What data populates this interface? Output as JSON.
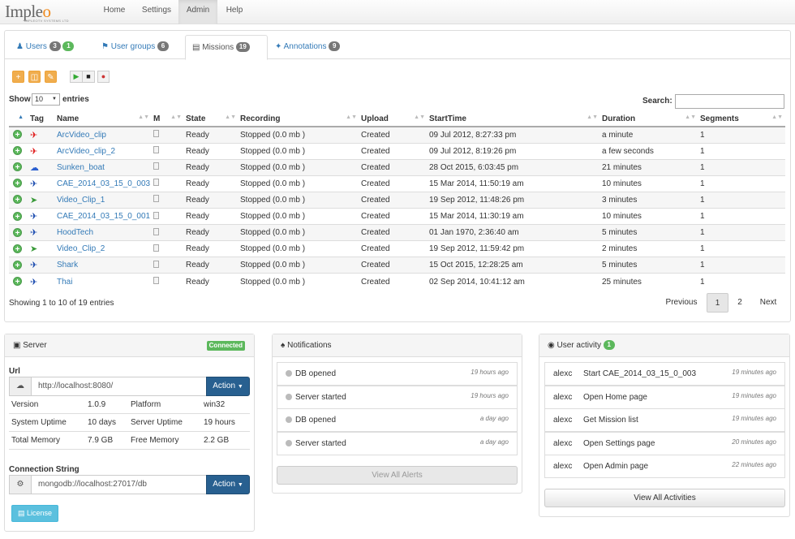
{
  "brand": {
    "logo": "Impleo",
    "logo_sub": "IMPLEOTV SYSTEMS LTD"
  },
  "nav": {
    "items": [
      {
        "label": "Home"
      },
      {
        "label": "Settings"
      },
      {
        "label": "Admin"
      },
      {
        "label": "Help"
      }
    ]
  },
  "tabs": [
    {
      "label": "Users",
      "icon": "user-icon",
      "badges": [
        "3",
        "1"
      ]
    },
    {
      "label": "User groups",
      "icon": "tags-icon",
      "badges": [
        "6"
      ]
    },
    {
      "label": "Missions",
      "icon": "film-icon",
      "badges": [
        "19"
      ]
    },
    {
      "label": "Annotations",
      "icon": "pushpin-icon",
      "badges": [
        "9"
      ]
    }
  ],
  "table": {
    "show_label": "Show",
    "entries_label": "entries",
    "page_size": "10",
    "search_label": "Search:",
    "columns": [
      "Tag",
      "Name",
      "M",
      "State",
      "Recording",
      "Upload",
      "StartTime",
      "Duration",
      "Segments"
    ],
    "rows": [
      {
        "tag": "jet-red-icon",
        "name": "ArcVideo_clip",
        "state": "Ready",
        "recording": "Stopped (0.0 mb )",
        "upload": "Created",
        "start": "09 Jul 2012, 8:27:33 pm",
        "duration": "a minute",
        "segments": "1"
      },
      {
        "tag": "jet-red-icon",
        "name": "ArcVideo_clip_2",
        "state": "Ready",
        "recording": "Stopped (0.0 mb )",
        "upload": "Created",
        "start": "09 Jul 2012, 8:19:26 pm",
        "duration": "a few seconds",
        "segments": "1"
      },
      {
        "tag": "cloud-blue-icon",
        "name": "Sunken_boat",
        "state": "Ready",
        "recording": "Stopped (0.0 mb )",
        "upload": "Created",
        "start": "28 Oct 2015, 6:03:45 pm",
        "duration": "21 minutes",
        "segments": "1"
      },
      {
        "tag": "plane-blue-icon",
        "name": "CAE_2014_03_15_0_003",
        "state": "Ready",
        "recording": "Stopped (0.0 mb )",
        "upload": "Created",
        "start": "15 Mar 2014, 11:50:19 am",
        "duration": "10 minutes",
        "segments": "1"
      },
      {
        "tag": "paper-plane-green-icon",
        "name": "Video_Clip_1",
        "state": "Ready",
        "recording": "Stopped (0.0 mb )",
        "upload": "Created",
        "start": "19 Sep 2012, 11:48:26 pm",
        "duration": "3 minutes",
        "segments": "1"
      },
      {
        "tag": "plane-blue-icon",
        "name": "CAE_2014_03_15_0_001",
        "state": "Ready",
        "recording": "Stopped (0.0 mb )",
        "upload": "Created",
        "start": "15 Mar 2014, 11:30:19 am",
        "duration": "10 minutes",
        "segments": "1"
      },
      {
        "tag": "plane-blue-icon",
        "name": "HoodTech",
        "state": "Ready",
        "recording": "Stopped (0.0 mb )",
        "upload": "Created",
        "start": "01 Jan 1970, 2:36:40 am",
        "duration": "5 minutes",
        "segments": "1"
      },
      {
        "tag": "paper-plane-green-icon",
        "name": "Video_Clip_2",
        "state": "Ready",
        "recording": "Stopped (0.0 mb )",
        "upload": "Created",
        "start": "19 Sep 2012, 11:59:42 pm",
        "duration": "2 minutes",
        "segments": "1"
      },
      {
        "tag": "plane-blue-icon",
        "name": "Shark",
        "state": "Ready",
        "recording": "Stopped (0.0 mb )",
        "upload": "Created",
        "start": "15 Oct 2015, 12:28:25 am",
        "duration": "5 minutes",
        "segments": "1"
      },
      {
        "tag": "plane-blue-icon",
        "name": "Thai",
        "state": "Ready",
        "recording": "Stopped (0.0 mb )",
        "upload": "Created",
        "start": "02 Sep 2014, 10:41:12 am",
        "duration": "25 minutes",
        "segments": "1"
      }
    ],
    "info": "Showing 1 to 10 of 19 entries",
    "pagination": {
      "previous": "Previous",
      "pages": [
        "1",
        "2"
      ],
      "next": "Next",
      "current": "1"
    }
  },
  "server": {
    "title": "Server",
    "status": "Connected",
    "url_label": "Url",
    "url": "http://localhost:8080/",
    "action": "Action",
    "info": [
      [
        "Version",
        "1.0.9",
        "Platform",
        "win32"
      ],
      [
        "System Uptime",
        "10 days",
        "Server Uptime",
        "19 hours"
      ],
      [
        "Total Memory",
        "7.9 GB",
        "Free Memory",
        "2.2 GB"
      ]
    ],
    "conn_label": "Connection String",
    "conn": "mongodb://localhost:27017/db",
    "conn_action": "Action",
    "license": "License"
  },
  "notifications": {
    "title": "Notifications",
    "items": [
      {
        "text": "DB opened",
        "time": "19 hours ago"
      },
      {
        "text": "Server started",
        "time": "19 hours ago"
      },
      {
        "text": "DB opened",
        "time": "a day ago"
      },
      {
        "text": "Server started",
        "time": "a day ago"
      }
    ],
    "button": "View All Alerts"
  },
  "activity": {
    "title": "User activity",
    "badge": "1",
    "items": [
      {
        "user": "alexc",
        "text": "Start CAE_2014_03_15_0_003",
        "time": "19 minutes ago"
      },
      {
        "user": "alexc",
        "text": "Open Home page",
        "time": "19 minutes ago"
      },
      {
        "user": "alexc",
        "text": "Get Mission list",
        "time": "19 minutes ago"
      },
      {
        "user": "alexc",
        "text": "Open Settings page",
        "time": "20 minutes ago"
      },
      {
        "user": "alexc",
        "text": "Open Admin page",
        "time": "22 minutes ago"
      }
    ],
    "button": "View All Activities"
  },
  "colors": {
    "accent": "#337ab7",
    "success": "#5cb85c",
    "warning": "#f0ad4e",
    "primary_dark": "#286090"
  }
}
